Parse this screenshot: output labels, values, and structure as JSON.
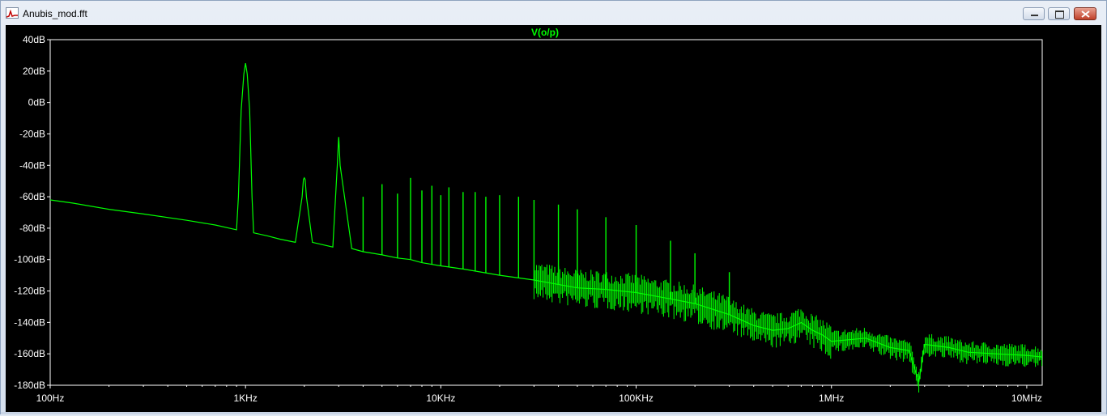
{
  "window": {
    "title": "Anubis_mod.fft"
  },
  "controls": {
    "minimize": "minimize",
    "maximize": "maximize",
    "close": "close"
  },
  "colors": {
    "trace": "#00ff00",
    "background": "#000000",
    "axis": "#ffffff"
  },
  "chart_data": {
    "type": "line",
    "title": "V(o/p)",
    "xscale": "log",
    "xlim": [
      100,
      12000000
    ],
    "ylim": [
      -180,
      40
    ],
    "xticks": [
      {
        "v": 100,
        "label": "100Hz"
      },
      {
        "v": 1000,
        "label": "1KHz"
      },
      {
        "v": 10000,
        "label": "10KHz"
      },
      {
        "v": 100000,
        "label": "100KHz"
      },
      {
        "v": 1000000,
        "label": "1MHz"
      },
      {
        "v": 10000000,
        "label": "10MHz"
      }
    ],
    "yticks": [
      {
        "v": 40,
        "label": "40dB"
      },
      {
        "v": 20,
        "label": "20dB"
      },
      {
        "v": 0,
        "label": "0dB"
      },
      {
        "v": -20,
        "label": "-20dB"
      },
      {
        "v": -40,
        "label": "-40dB"
      },
      {
        "v": -60,
        "label": "-60dB"
      },
      {
        "v": -80,
        "label": "-80dB"
      },
      {
        "v": -100,
        "label": "-100dB"
      },
      {
        "v": -120,
        "label": "-120dB"
      },
      {
        "v": -140,
        "label": "-140dB"
      },
      {
        "v": -160,
        "label": "-160dB"
      },
      {
        "v": -180,
        "label": "-180dB"
      }
    ],
    "grid": false,
    "series": [
      {
        "name": "V(o/p)",
        "x": [
          100,
          130,
          200,
          300,
          500,
          700,
          900,
          920,
          950,
          980,
          1000,
          1020,
          1050,
          1080,
          1100,
          1300,
          1500,
          1800,
          1950,
          1980,
          2000,
          2020,
          2050,
          2200,
          2800,
          2950,
          2990,
          3000,
          3010,
          3050,
          3500,
          4000,
          4500,
          5000,
          6000,
          7000,
          8000,
          10000,
          13000,
          20000,
          30000,
          50000,
          70000,
          100000,
          150000,
          200000,
          300000,
          400000,
          500000,
          600000,
          700000,
          800000,
          900000,
          1000000,
          1500000,
          2000000,
          2500000,
          2800000,
          3000000,
          4000000,
          5000000,
          7000000,
          10000000,
          12000000
        ],
        "y": [
          -62,
          -64,
          -68,
          -71,
          -75,
          -78,
          -81,
          -60,
          -5,
          18,
          25,
          18,
          -5,
          -60,
          -83,
          -85,
          -87,
          -89,
          -60,
          -49,
          -48,
          -49,
          -60,
          -89,
          -92,
          -40,
          -25,
          -22,
          -25,
          -40,
          -93,
          -95,
          -96,
          -97,
          -99,
          -100,
          -102,
          -104,
          -106,
          -110,
          -113,
          -118,
          -119,
          -121,
          -125,
          -128,
          -135,
          -142,
          -145,
          -144,
          -140,
          -145,
          -148,
          -152,
          -150,
          -156,
          -158,
          -178,
          -154,
          -156,
          -159,
          -160,
          -161,
          -162
        ]
      }
    ],
    "harmonic_peaks": [
      {
        "x": 4000,
        "y": -60
      },
      {
        "x": 5000,
        "y": -52
      },
      {
        "x": 6000,
        "y": -58
      },
      {
        "x": 7000,
        "y": -48
      },
      {
        "x": 8000,
        "y": -56
      },
      {
        "x": 9000,
        "y": -53
      },
      {
        "x": 10000,
        "y": -59
      },
      {
        "x": 11000,
        "y": -54
      },
      {
        "x": 13000,
        "y": -57
      },
      {
        "x": 15000,
        "y": -57
      },
      {
        "x": 17000,
        "y": -60
      },
      {
        "x": 20000,
        "y": -59
      },
      {
        "x": 25000,
        "y": -60
      },
      {
        "x": 30000,
        "y": -62
      },
      {
        "x": 40000,
        "y": -65
      },
      {
        "x": 50000,
        "y": -68
      },
      {
        "x": 70000,
        "y": -73
      },
      {
        "x": 100000,
        "y": -78
      },
      {
        "x": 150000,
        "y": -88
      },
      {
        "x": 200000,
        "y": -96
      },
      {
        "x": 300000,
        "y": -108
      }
    ]
  }
}
